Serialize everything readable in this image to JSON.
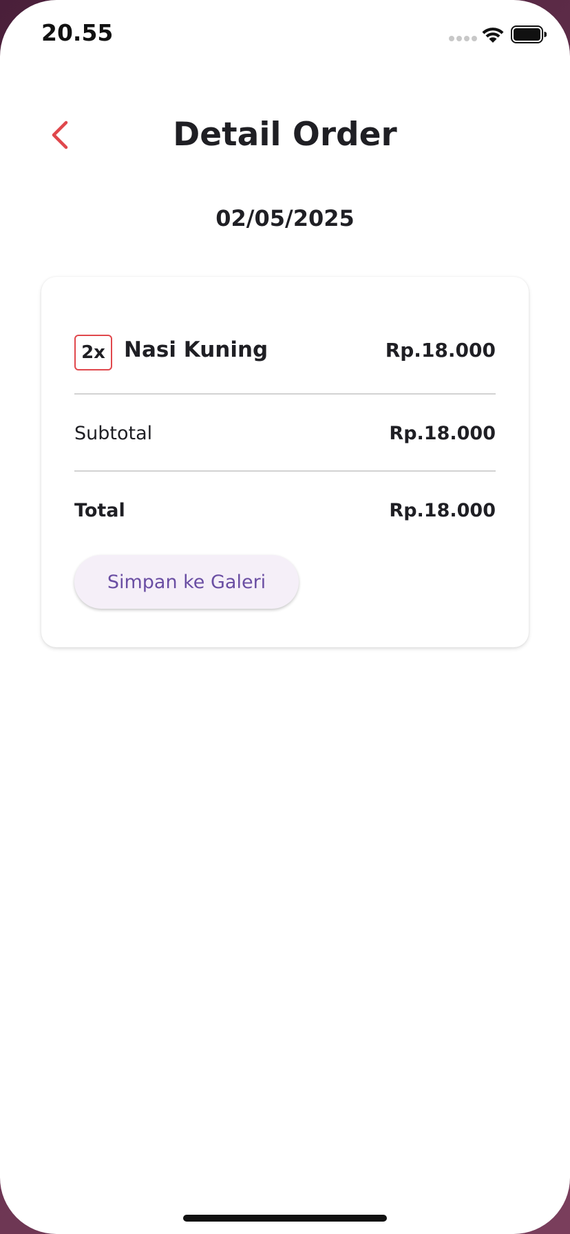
{
  "status_bar": {
    "time": "20.55"
  },
  "header": {
    "title": "Detail Order"
  },
  "order": {
    "date": "02/05/2025",
    "items": [
      {
        "quantity": "2x",
        "name": "Nasi Kuning",
        "price": "Rp.18.000"
      }
    ],
    "subtotal_label": "Subtotal",
    "subtotal_value": "Rp.18.000",
    "total_label": "Total",
    "total_value": "Rp.18.000"
  },
  "actions": {
    "save_label": "Simpan ke Galeri"
  },
  "colors": {
    "accent": "#e0474c",
    "button_text": "#6a4ea3",
    "button_bg": "#f5eff8",
    "text": "#1f1f24"
  },
  "icons": {
    "back": "chevron-left-icon",
    "wifi": "wifi-icon",
    "battery": "battery-icon",
    "signal": "signal-icon"
  }
}
